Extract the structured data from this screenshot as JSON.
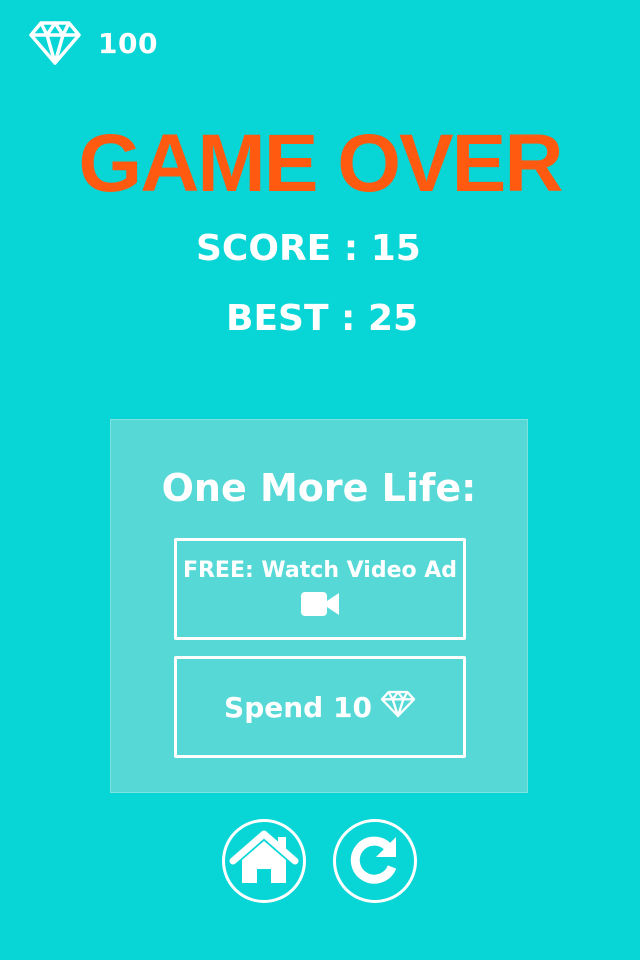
{
  "hud": {
    "gem_icon": "diamond-icon",
    "gem_count": "100"
  },
  "title": "GAME OVER",
  "stats": {
    "score_text": "SCORE : 15",
    "best_text": "BEST : 25",
    "score": 15,
    "best": 25
  },
  "revive_panel": {
    "title": "One More Life:",
    "video_option": {
      "label": "FREE: Watch Video Ad",
      "icon": "video-camera-icon"
    },
    "spend_option": {
      "label": "Spend 10",
      "icon": "diamond-icon"
    }
  },
  "bottom_buttons": {
    "home_icon": "home-icon",
    "replay_icon": "replay-icon"
  },
  "colors": {
    "background": "#07d5d6",
    "title": "#ff5a10",
    "panel": "#56d9d6",
    "foreground": "#ffffff"
  }
}
